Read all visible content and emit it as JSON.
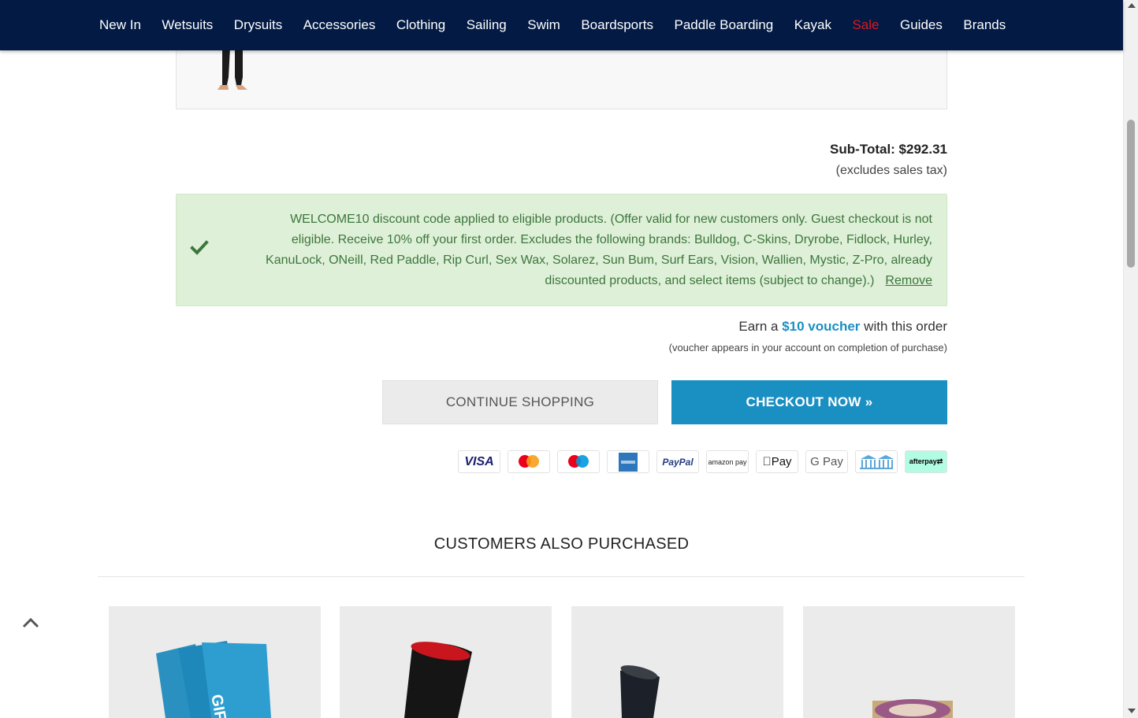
{
  "nav": {
    "items": [
      {
        "label": "New In"
      },
      {
        "label": "Wetsuits"
      },
      {
        "label": "Drysuits"
      },
      {
        "label": "Accessories"
      },
      {
        "label": "Clothing"
      },
      {
        "label": "Sailing"
      },
      {
        "label": "Swim"
      },
      {
        "label": "Boardsports"
      },
      {
        "label": "Paddle Boarding"
      },
      {
        "label": "Kayak"
      },
      {
        "label": "Sale"
      },
      {
        "label": "Guides"
      },
      {
        "label": "Brands"
      }
    ]
  },
  "cart": {
    "subtotal_label": "Sub-Total: $292.31",
    "tax_note": "(excludes sales tax)"
  },
  "discount": {
    "message": "WELCOME10 discount code applied to eligible products. (Offer valid for new customers only. Guest checkout is not eligible. Receive 10% off your first order. Excludes the following brands: Bulldog, C-Skins, Dryrobe, Fidlock, Hurley, KanuLock, ONeill, Red Paddle, Rip Curl, Sex Wax, Solarez, Sun Bum, Surf Ears, Vision, Wallien, Mystic, Z-Pro, already discounted products, and select items (subject to change).)",
    "remove_label": "Remove",
    "icon": "check-icon"
  },
  "voucher": {
    "prefix": "Earn a",
    "amount": "$10 voucher",
    "suffix": "with this order",
    "note": "(voucher appears in your account on completion of purchase)"
  },
  "buttons": {
    "continue_label": "CONTINUE SHOPPING",
    "checkout_label": "CHECKOUT NOW »"
  },
  "payments": {
    "visa": "VISA",
    "paypal": "PayPal",
    "amazon": "amazon pay",
    "apple": "Pay",
    "gpay": "G Pay",
    "afterpay": "afterpay⇄"
  },
  "also_purchased": {
    "title": "CUSTOMERS ALSO PURCHASED",
    "gift_card_text": "GIFT"
  },
  "colors": {
    "nav_bg": "#021a44",
    "sale": "#e0161f",
    "accent": "#1a8fc2",
    "success_bg": "#dff0d8",
    "success_text": "#3c763d"
  }
}
